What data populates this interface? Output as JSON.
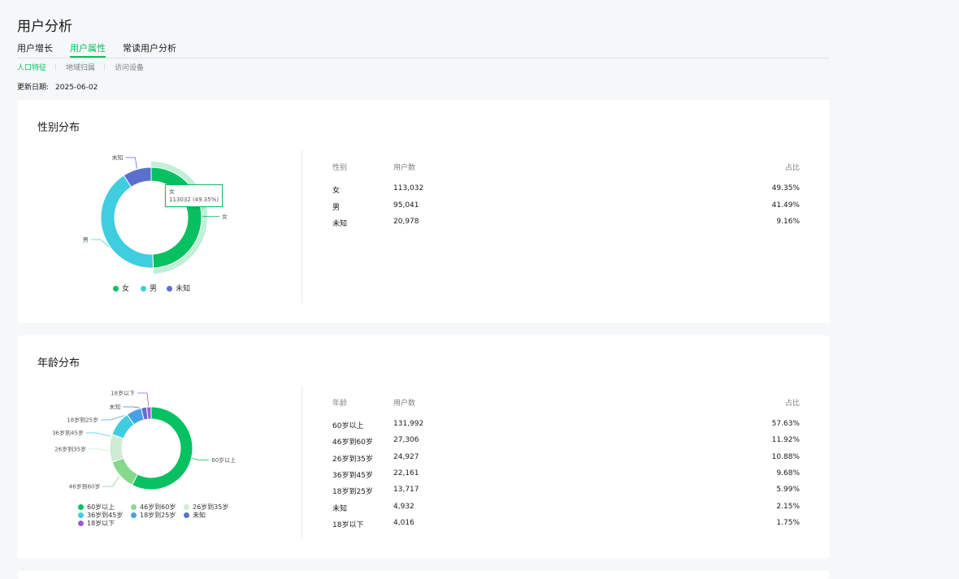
{
  "page": {
    "title": "用户分析"
  },
  "tabs": [
    "用户增长",
    "用户属性",
    "常读用户分析"
  ],
  "subtabs": [
    "人口特征",
    "地域归属",
    "访问设备"
  ],
  "update": {
    "label": "更新日期:",
    "date": "2025-06-02"
  },
  "gender": {
    "title": "性别分布",
    "headers": {
      "col1": "性别",
      "col2": "用户数",
      "col3": "占比"
    },
    "rows": [
      {
        "name": "女",
        "count": "113,032",
        "pct": "49.35%"
      },
      {
        "name": "男",
        "count": "95,041",
        "pct": "41.49%"
      },
      {
        "name": "未知",
        "count": "20,978",
        "pct": "9.16%"
      }
    ],
    "tooltip": {
      "name": "女",
      "value": "113032 (49.35%)"
    },
    "legend": [
      "女",
      "男",
      "未知"
    ]
  },
  "age": {
    "title": "年龄分布",
    "headers": {
      "col1": "年龄",
      "col2": "用户数",
      "col3": "占比"
    },
    "rows": [
      {
        "name": "60岁以上",
        "count": "131,992",
        "pct": "57.63%"
      },
      {
        "name": "46岁到60岁",
        "count": "27,306",
        "pct": "11.92%"
      },
      {
        "name": "26岁到35岁",
        "count": "24,927",
        "pct": "10.88%"
      },
      {
        "name": "36岁到45岁",
        "count": "22,161",
        "pct": "9.68%"
      },
      {
        "name": "18岁到25岁",
        "count": "13,717",
        "pct": "5.99%"
      },
      {
        "name": "未知",
        "count": "4,932",
        "pct": "2.15%"
      },
      {
        "name": "18岁以下",
        "count": "4,016",
        "pct": "1.75%"
      }
    ],
    "legend": [
      "60岁以上",
      "46岁到60岁",
      "26岁到35岁",
      "36岁到45岁",
      "18岁到25岁",
      "未知",
      "18岁以下"
    ]
  },
  "chart_data": [
    {
      "type": "pie",
      "title": "性别分布",
      "categories": [
        "女",
        "男",
        "未知"
      ],
      "values": [
        113032,
        95041,
        20978
      ],
      "colors": [
        "#07c160",
        "#3fcde0",
        "#5b6fce"
      ],
      "highlight": "女"
    },
    {
      "type": "pie",
      "title": "年龄分布",
      "categories": [
        "60岁以上",
        "46岁到60岁",
        "26岁到35岁",
        "36岁到45岁",
        "18岁到25岁",
        "未知",
        "18岁以下"
      ],
      "values": [
        131992,
        27306,
        24927,
        22161,
        13717,
        4932,
        4016
      ],
      "colors": [
        "#07c160",
        "#86d88b",
        "#cdecd1",
        "#3fcde0",
        "#4aa0e6",
        "#5b6fce",
        "#9a5fd0"
      ]
    }
  ]
}
